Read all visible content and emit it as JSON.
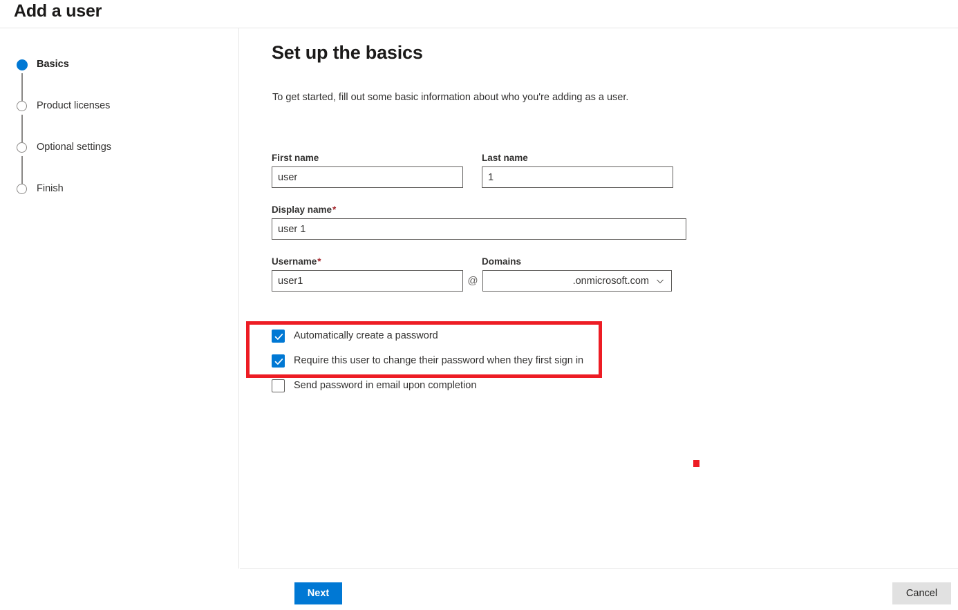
{
  "header": {
    "title": "Add a user"
  },
  "sidebar": {
    "steps": [
      {
        "label": "Basics",
        "state": "active"
      },
      {
        "label": "Product licenses",
        "state": "inactive"
      },
      {
        "label": "Optional settings",
        "state": "inactive"
      },
      {
        "label": "Finish",
        "state": "inactive"
      }
    ]
  },
  "main": {
    "heading": "Set up the basics",
    "description": "To get started, fill out some basic information about who you're adding as a user.",
    "fields": {
      "first_name": {
        "label": "First name",
        "value": "user",
        "required": false
      },
      "last_name": {
        "label": "Last name",
        "value": "1",
        "required": false
      },
      "display_name": {
        "label": "Display name",
        "value": "user 1",
        "required": true,
        "required_mark": "*"
      },
      "username": {
        "label": "Username",
        "value": "user1",
        "required": true,
        "required_mark": "*"
      },
      "domains": {
        "label": "Domains",
        "value": ".onmicrosoft.com",
        "separator": "@"
      }
    },
    "checkboxes": [
      {
        "label": "Automatically create a password",
        "checked": true
      },
      {
        "label": "Require this user to change their password when they first sign in",
        "checked": true
      },
      {
        "label": "Send password in email upon completion",
        "checked": false
      }
    ]
  },
  "footer": {
    "next_label": "Next",
    "cancel_label": "Cancel"
  },
  "colors": {
    "accent": "#0078d4",
    "annotation": "#ed1c24",
    "required": "#a4262c",
    "border": "#605e5c"
  }
}
